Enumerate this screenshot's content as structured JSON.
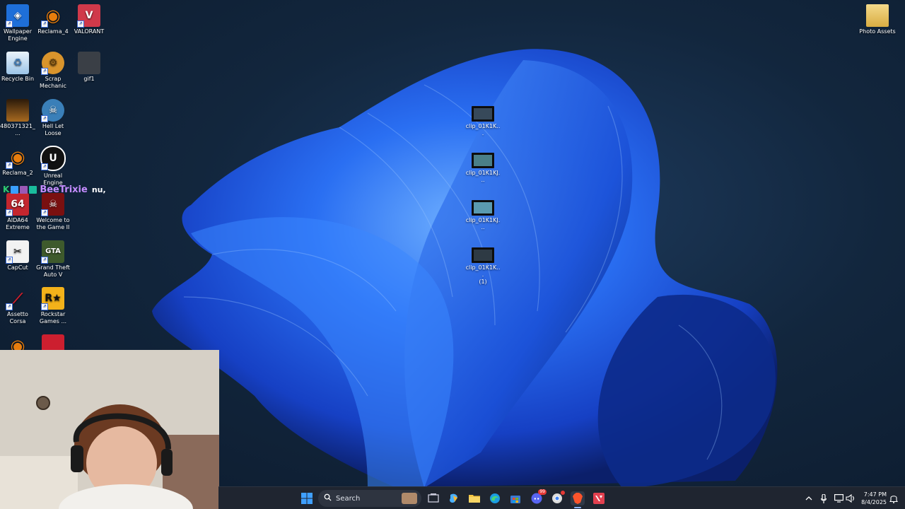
{
  "desktop": {
    "left_icons": [
      {
        "label": "Wallpaper Engine",
        "icon": "wallpaper-engine-icon",
        "color": "#1e6fd9"
      },
      {
        "label": "Reclama_4",
        "icon": "blender-icon",
        "color": "#e87d0d"
      },
      {
        "label": "VALORANT",
        "icon": "valorant-icon",
        "color": "#d0394a"
      },
      {
        "label": "Recycle Bin",
        "icon": "recycle-bin-icon",
        "color": "#9cc5e8"
      },
      {
        "label": "Scrap Mechanic",
        "icon": "scrap-mechanic-icon",
        "color": "#d9942c"
      },
      {
        "label": "gif1",
        "icon": "gif-file-icon",
        "color": "#3a3f46"
      },
      {
        "label": "480371321_...",
        "icon": "image-file-icon",
        "color": "#6b4a1e"
      },
      {
        "label": "Hell Let Loose",
        "icon": "hell-let-loose-icon",
        "color": "#3a7fb8"
      },
      {
        "label": "Reclama_2",
        "icon": "blender-icon",
        "color": "#e87d0d"
      },
      {
        "label": "Unreal Engine",
        "icon": "unreal-engine-icon",
        "color": "#111111"
      },
      {
        "label": "AIDA64 Extreme",
        "icon": "aida64-icon",
        "color": "#c4262e"
      },
      {
        "label": "Welcome to the Game II",
        "icon": "skull-icon",
        "color": "#7a1010"
      },
      {
        "label": "CapCut",
        "icon": "capcut-icon",
        "color": "#f2f2f2"
      },
      {
        "label": "Grand Theft Auto V",
        "icon": "gta-v-icon",
        "color": "#3e5a2c"
      },
      {
        "label": "Assetto Corsa",
        "icon": "assetto-corsa-icon",
        "color": "#cc1f2f"
      },
      {
        "label": "Rockstar Games ...",
        "icon": "rockstar-icon",
        "color": "#f3b21a"
      }
    ],
    "right_icons": [
      {
        "label": "Photo Assets",
        "icon": "folder-icon",
        "color": "#e7c46a"
      }
    ],
    "clips": [
      {
        "label": "clip_01K1K..."
      },
      {
        "label": "clip_01K1KJ..."
      },
      {
        "label": "clip_01K1KJ..."
      },
      {
        "label": "clip_01K1K...",
        "suffix": "(1)"
      }
    ]
  },
  "overlay": {
    "badge_letter": "K",
    "username": "BeeTrixie",
    "message": "nu,",
    "username_color": "#c58cff",
    "badge_colors": [
      "#2ecc71",
      "#3aa0ff",
      "#9b59b6",
      "#1abc9c"
    ]
  },
  "taskbar": {
    "search_placeholder": "Search",
    "time": "7:47 PM",
    "date": "8/4/2025",
    "apps": [
      "windows-start-icon",
      "widgets-icon",
      "task-view-icon",
      "copilot-icon",
      "file-explorer-icon",
      "edge-icon",
      "store-icon",
      "discord-icon",
      "chrome-icon",
      "brave-icon",
      "valorant-icon"
    ],
    "tray": [
      "chevron-up-icon",
      "microphone-icon",
      "display-icon",
      "volume-icon",
      "notifications-icon"
    ],
    "discord_badge": "99"
  },
  "colors": {
    "wallpaper_bloom": "#1a5cf0",
    "taskbar_bg": "#1f2530"
  }
}
